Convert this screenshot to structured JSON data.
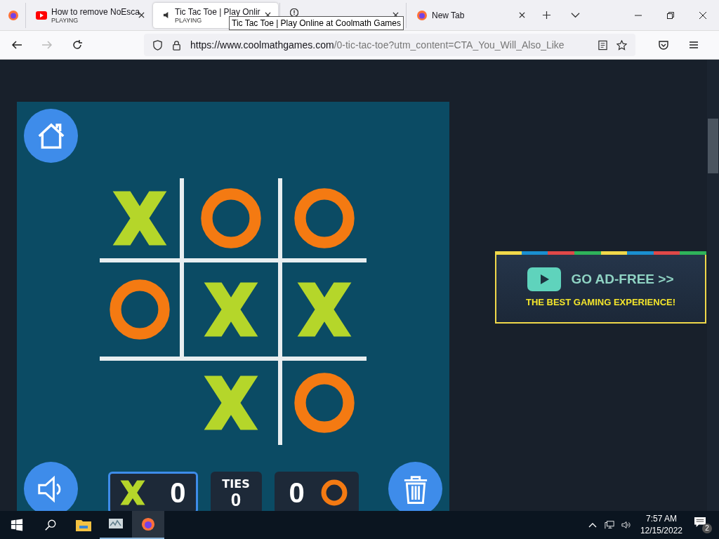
{
  "browser": {
    "tabs": [
      {
        "title": "How to remove NoEsca",
        "status": "PLAYING",
        "kind": "video",
        "selected": false
      },
      {
        "title": "Tic Tac Toe | Play Onlir",
        "status": "PLAYING",
        "kind": "audio",
        "selected": true
      },
      {
        "kind": "error",
        "selected": false
      },
      {
        "title": "New Tab",
        "kind": "browser",
        "selected": false
      }
    ],
    "tooltip": "Tic Tac Toe | Play Online at Coolmath Games",
    "url": {
      "domain": "https://www.coolmathgames.com",
      "path": "/0-tic-tac-toe?utm_content=CTA_You_Will_Also_Like"
    }
  },
  "game": {
    "board": [
      {
        "kind": "x"
      },
      {
        "kind": "o"
      },
      {
        "kind": "o"
      },
      {
        "kind": "o"
      },
      {
        "kind": "x"
      },
      {
        "kind": "x"
      },
      {
        "kind": "empty"
      },
      {
        "kind": "x"
      },
      {
        "kind": "o"
      }
    ],
    "scores": [
      {
        "kind": "x",
        "value": "0",
        "selected": true
      },
      {
        "kind": "ties",
        "label": "TIES",
        "value": "0",
        "selected": false
      },
      {
        "kind": "o",
        "value": "0",
        "selected": false
      }
    ]
  },
  "ad": {
    "headline": "GO AD-FREE >>",
    "tagline": "THE BEST GAMING EXPERIENCE!"
  },
  "taskbar": {
    "time": "7:57 AM",
    "date": "12/15/2022",
    "notifications": "2"
  }
}
